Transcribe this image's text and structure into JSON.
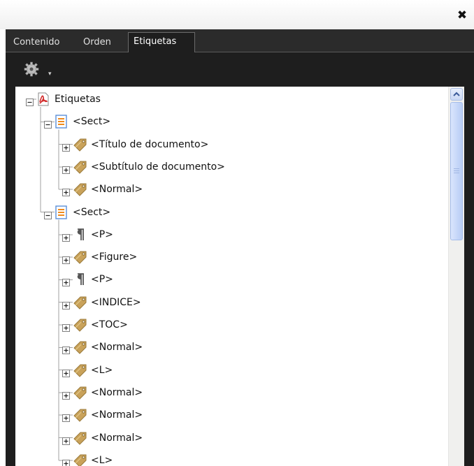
{
  "window": {
    "close_symbol": "✖"
  },
  "tabs": [
    {
      "label": "Contenido",
      "active": false
    },
    {
      "label": "Orden",
      "active": false
    },
    {
      "label": "Etiquetas",
      "active": true
    }
  ],
  "toolbar": {
    "options_icon": "gear-icon",
    "options_arrow": "▾"
  },
  "tree": {
    "root": {
      "label": "Etiquetas",
      "icon": "pdf-icon",
      "expanded": true
    },
    "nodes": [
      {
        "label": "<Sect>",
        "icon": "section-icon",
        "expanded": true,
        "level": 1
      },
      {
        "label": "<Título de documento>",
        "icon": "tag-icon",
        "expanded": false,
        "level": 2
      },
      {
        "label": "<Subtítulo de documento>",
        "icon": "tag-icon",
        "expanded": false,
        "level": 2
      },
      {
        "label": "<Normal>",
        "icon": "tag-icon",
        "expanded": false,
        "level": 2
      },
      {
        "label": "<Sect>",
        "icon": "section-icon",
        "expanded": true,
        "level": 1
      },
      {
        "label": "<P>",
        "icon": "paragraph-icon",
        "expanded": false,
        "level": 2
      },
      {
        "label": "<Figure>",
        "icon": "tag-icon",
        "expanded": false,
        "level": 2
      },
      {
        "label": "<P>",
        "icon": "paragraph-icon",
        "expanded": false,
        "level": 2
      },
      {
        "label": "<INDICE>",
        "icon": "tag-icon",
        "expanded": false,
        "level": 2
      },
      {
        "label": "<TOC>",
        "icon": "tag-icon",
        "expanded": false,
        "level": 2
      },
      {
        "label": "<Normal>",
        "icon": "tag-icon",
        "expanded": false,
        "level": 2
      },
      {
        "label": "<L>",
        "icon": "tag-icon",
        "expanded": false,
        "level": 2
      },
      {
        "label": "<Normal>",
        "icon": "tag-icon",
        "expanded": false,
        "level": 2
      },
      {
        "label": "<Normal>",
        "icon": "tag-icon",
        "expanded": false,
        "level": 2
      },
      {
        "label": "<Normal>",
        "icon": "tag-icon",
        "expanded": false,
        "level": 2
      },
      {
        "label": "<L>",
        "icon": "tag-icon",
        "expanded": false,
        "level": 2
      }
    ]
  },
  "colors": {
    "panel_background": "#1e1e1e",
    "tree_background": "#ffffff",
    "tag_icon": "#c9a25a",
    "pdf_icon": "#d22b2b",
    "section_icon_border": "#5a8fd8",
    "section_icon_lines": "#f08a1c",
    "scrollbar_thumb": "#c5d6f8"
  },
  "scrollbar": {
    "position_fraction": 0.0
  }
}
